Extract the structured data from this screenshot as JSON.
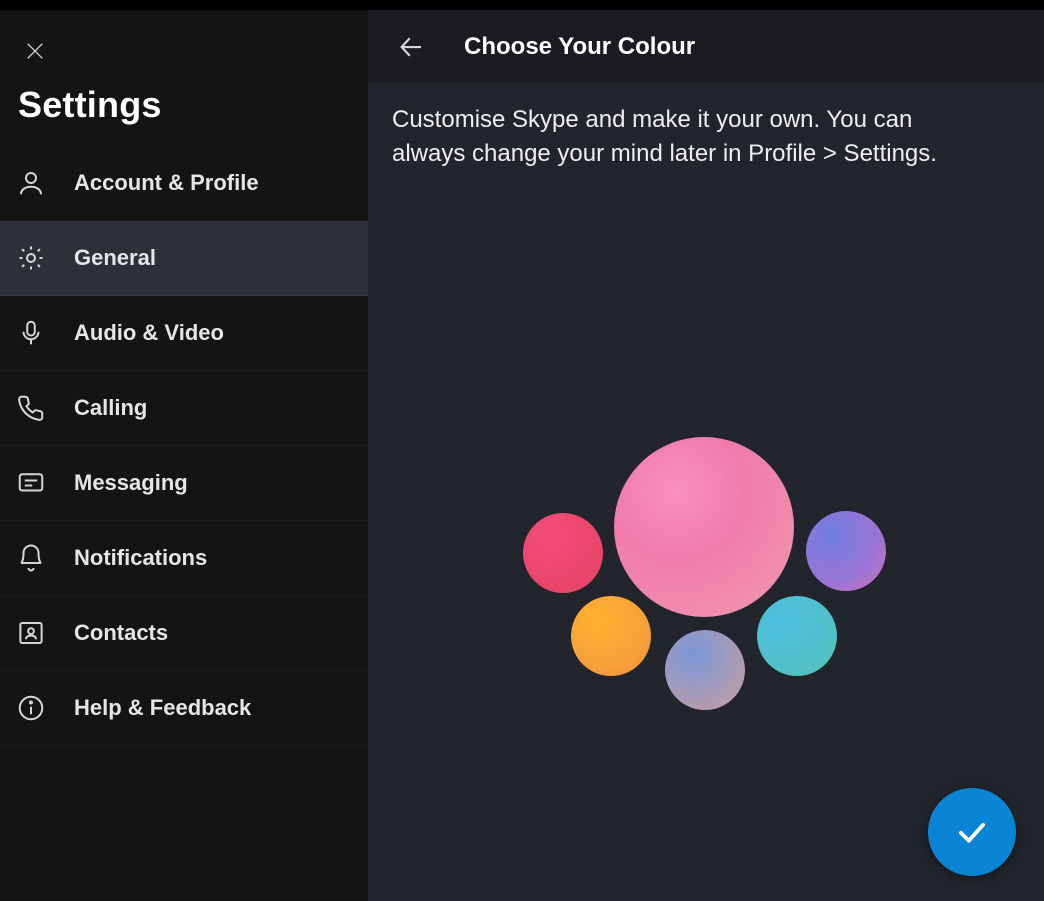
{
  "sidebar": {
    "title": "Settings",
    "items": [
      {
        "id": "account",
        "label": "Account & Profile"
      },
      {
        "id": "general",
        "label": "General"
      },
      {
        "id": "audio-video",
        "label": "Audio & Video"
      },
      {
        "id": "calling",
        "label": "Calling"
      },
      {
        "id": "messaging",
        "label": "Messaging"
      },
      {
        "id": "notifications",
        "label": "Notifications"
      },
      {
        "id": "contacts",
        "label": "Contacts"
      },
      {
        "id": "help",
        "label": "Help & Feedback"
      }
    ],
    "active_id": "general"
  },
  "main": {
    "title": "Choose Your Colour",
    "description": "Customise Skype and make it your own. You can always change your mind later in Profile > Settings.",
    "colour_options": [
      {
        "id": "pink-large",
        "name": "pink",
        "selected": true
      },
      {
        "id": "red",
        "name": "red",
        "selected": false
      },
      {
        "id": "orange",
        "name": "orange",
        "selected": false
      },
      {
        "id": "muted",
        "name": "blue-muted",
        "selected": false
      },
      {
        "id": "teal",
        "name": "teal",
        "selected": false
      },
      {
        "id": "purple",
        "name": "purple-blue",
        "selected": false
      }
    ]
  },
  "colors": {
    "accent": "#0a85d6",
    "sidebar_bg": "#141414",
    "main_bg": "#23252c",
    "header_bg": "#1b1c21",
    "active_bg": "#2b3136"
  }
}
